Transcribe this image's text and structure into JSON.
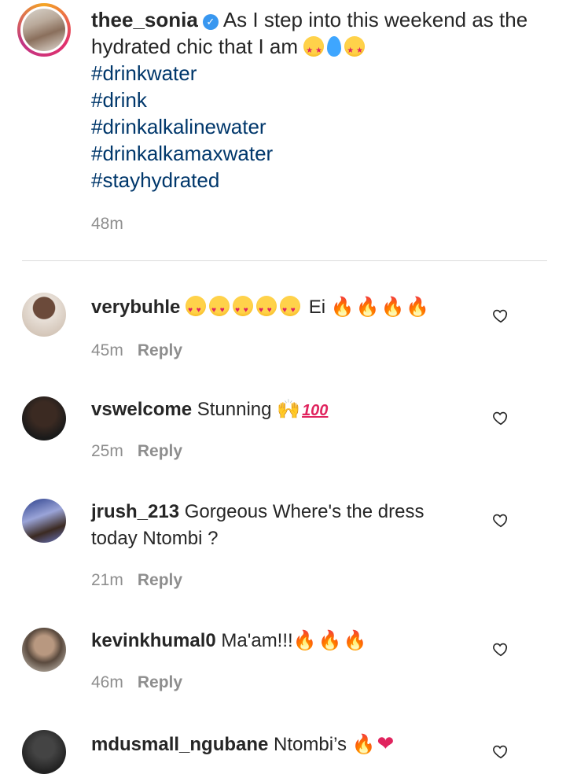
{
  "post": {
    "username": "thee_sonia",
    "text": "As I step into this weekend as the hydrated chic that I am",
    "hashtags": [
      "#drinkwater",
      "#drink",
      "#drinkalkalinewater",
      "#drinkalkamaxwater",
      "#stayhydrated"
    ],
    "time": "48m"
  },
  "reply_label": "Reply",
  "comments": [
    {
      "username": "verybuhle",
      "text_before": "",
      "text_after": "Ei",
      "time": "45m"
    },
    {
      "username": "vswelcome",
      "text": "Stunning",
      "time": "25m"
    },
    {
      "username": "jrush_213",
      "text": "Gorgeous Where's the dress today Ntombi ?",
      "time": "21m"
    },
    {
      "username": "kevinkhumal0",
      "text": "Ma'am!!!",
      "time": "46m"
    },
    {
      "username": "mdusmall_ngubane",
      "text": "Ntombi’s",
      "time": ""
    }
  ],
  "icons": {
    "verified": "verified-badge-icon",
    "like": "heart-outline-icon",
    "emoji": [
      "heart-eyes",
      "droplet",
      "star-eyes",
      "fire",
      "raising-hands",
      "hundred-points",
      "red-heart"
    ]
  },
  "colors": {
    "hashtag": "#00376b",
    "muted": "#8e8e8e",
    "verified": "#3897f0",
    "text": "#262626"
  }
}
